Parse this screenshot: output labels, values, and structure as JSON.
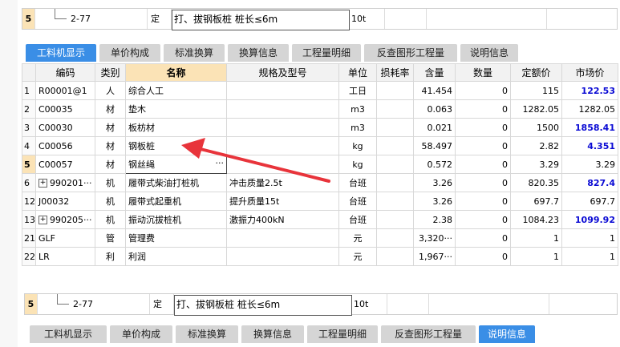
{
  "top_row": {
    "row_num": "5",
    "code": "2-77",
    "type": "定",
    "name": "打、拔钢板桩 桩长≤6m",
    "unit": "10t"
  },
  "tabs_top": [
    {
      "label": "工料机显示",
      "active": true
    },
    {
      "label": "单价构成"
    },
    {
      "label": "标准换算"
    },
    {
      "label": "换算信息"
    },
    {
      "label": "工程量明细"
    },
    {
      "label": "反查图形工程量"
    },
    {
      "label": "说明信息"
    }
  ],
  "table": {
    "headers": [
      "编码",
      "类别",
      "名称",
      "规格及型号",
      "单位",
      "损耗率",
      "含量",
      "数量",
      "定额价",
      "市场价"
    ],
    "rows": [
      {
        "idx": "1",
        "code": "R00001@1",
        "cat": "人",
        "name": "综合人工",
        "spec": "",
        "unit": "工日",
        "loss": "",
        "content": "41.454",
        "qty": "0",
        "quota": "115",
        "market": "122.53",
        "market_blue": true
      },
      {
        "idx": "2",
        "code": "C00035",
        "cat": "材",
        "name": "垫木",
        "spec": "",
        "unit": "m3",
        "loss": "",
        "content": "0.063",
        "qty": "0",
        "quota": "1282.05",
        "market": "1282.05"
      },
      {
        "idx": "3",
        "code": "C00030",
        "cat": "材",
        "name": "板枋材",
        "spec": "",
        "unit": "m3",
        "loss": "",
        "content": "0.021",
        "qty": "0",
        "quota": "1500",
        "market": "1858.41",
        "market_blue": true
      },
      {
        "idx": "4",
        "code": "C00056",
        "cat": "材",
        "name": "钢板桩",
        "spec": "",
        "unit": "kg",
        "loss": "",
        "content": "58.497",
        "qty": "0",
        "quota": "2.82",
        "market": "4.351",
        "market_blue": true
      },
      {
        "idx": "5",
        "code": "C00057",
        "cat": "材",
        "name": "钢丝绳",
        "name_suffix": "···",
        "spec": "",
        "unit": "kg",
        "loss": "",
        "content": "0.572",
        "qty": "0",
        "quota": "3.29",
        "market": "3.29",
        "selected": true
      },
      {
        "idx": "6",
        "code": "990201···",
        "cat": "机",
        "name": "履带式柴油打桩机",
        "spec": "冲击质量2.5t",
        "unit": "台班",
        "loss": "",
        "content": "3.26",
        "qty": "0",
        "quota": "820.35",
        "market": "827.4",
        "market_blue": true,
        "expand": "+"
      },
      {
        "idx": "12",
        "code": "J00032",
        "cat": "机",
        "name": "履带式起重机",
        "spec": "提升质量15t",
        "unit": "台班",
        "loss": "",
        "content": "3.26",
        "qty": "0",
        "quota": "697.7",
        "market": "697.7"
      },
      {
        "idx": "13",
        "code": "990205···",
        "cat": "机",
        "name": "振动沉拔桩机",
        "spec": "激振力400kN",
        "unit": "台班",
        "loss": "",
        "content": "2.38",
        "qty": "0",
        "quota": "1084.23",
        "market": "1099.92",
        "market_blue": true,
        "expand": "+"
      },
      {
        "idx": "21",
        "code": "GLF",
        "cat": "管",
        "name": "管理费",
        "spec": "",
        "unit": "元",
        "loss": "",
        "content": "3,320···",
        "qty": "0",
        "quota": "1",
        "market": "1"
      },
      {
        "idx": "22",
        "code": "LR",
        "cat": "利",
        "name": "利润",
        "spec": "",
        "unit": "元",
        "loss": "",
        "content": "1,967···",
        "qty": "0",
        "quota": "1",
        "market": "1"
      }
    ]
  },
  "bottom_row": {
    "row_num": "5",
    "code": "2-77",
    "type": "定",
    "name": "打、拔钢板桩 桩长≤6m",
    "unit": "10t"
  },
  "tabs_bottom": [
    {
      "label": "工料机显示"
    },
    {
      "label": "单价构成"
    },
    {
      "label": "标准换算"
    },
    {
      "label": "换算信息"
    },
    {
      "label": "工程量明细"
    },
    {
      "label": "反查图形工程量"
    },
    {
      "label": "说明信息",
      "active": true
    }
  ],
  "colors": {
    "tab_active": "#3a8ee6",
    "highlight": "#fbe3b6",
    "arrow": "#e8343b",
    "blue_value": "#0a0ad4"
  }
}
